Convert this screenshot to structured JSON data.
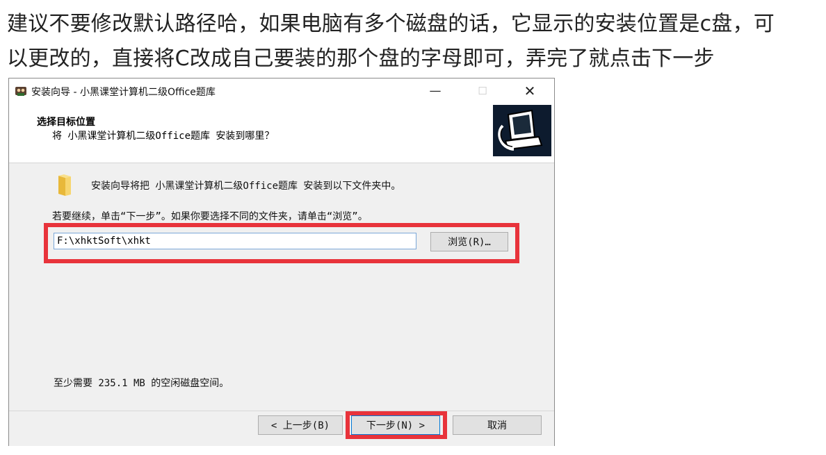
{
  "note": {
    "line1": "建议不要修改默认路径哈，如果电脑有多个磁盘的话，它显示的安装位置是c盘，可",
    "line2": "以更改的，直接将C改成自己要装的那个盘的字母即可，弄完了就点击下一步"
  },
  "window": {
    "title": "安装向导 - 小黑课堂计算机二级Office题库",
    "min_glyph": "—",
    "max_glyph": "☐",
    "close_glyph": "✕"
  },
  "header": {
    "title": "选择目标位置",
    "subtitle": "将 小黑课堂计算机二级Office题库 安装到哪里？"
  },
  "body": {
    "intro": "安装向导将把 小黑课堂计算机二级Office题库 安装到以下文件夹中。",
    "continue_text": "若要继续，单击“下一步”。如果你要选择不同的文件夹，请单击“浏览”。",
    "path_value": "F:\\xhktSoft\\xhkt",
    "browse_label": "浏览(R)…",
    "space_text": "至少需要 235.1 MB 的空闲磁盘空间。"
  },
  "footer": {
    "back_label": "< 上一步(B)",
    "next_label": "下一步(N) >",
    "cancel_label": "取消"
  },
  "colors": {
    "highlight": "#e8333b",
    "panel": "#f0f0f0",
    "focus_border": "#0078d7"
  },
  "icons": {
    "app": "installer-app-icon",
    "folder": "folder-icon",
    "wizard": "computer-install-icon"
  }
}
